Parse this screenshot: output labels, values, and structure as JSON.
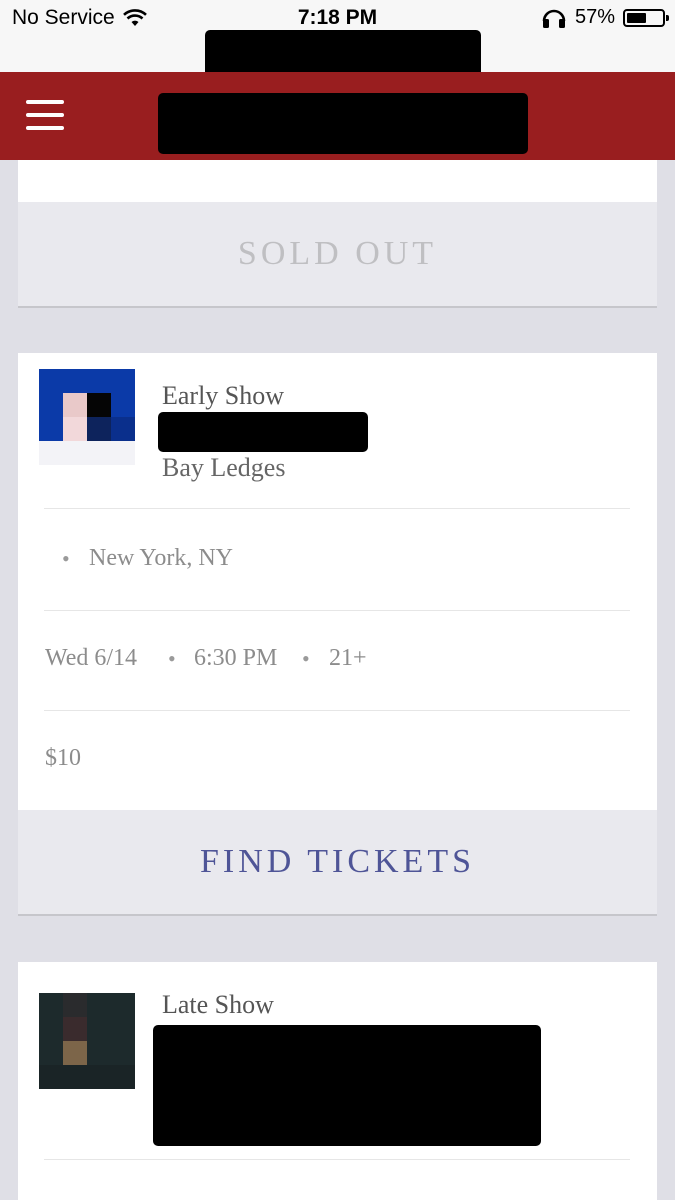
{
  "status_bar": {
    "carrier": "No Service",
    "time": "7:18 PM",
    "battery": "57%",
    "battery_level": 0.57
  },
  "nav": {
    "menu_icon": "hamburger-menu-icon"
  },
  "sold_out": {
    "label": "SOLD OUT"
  },
  "early_show": {
    "show_label": "Early Show",
    "artist": "Bay Ledges",
    "location": "New York, NY",
    "date": "Wed 6/14",
    "time": "6:30 PM",
    "age": "21+",
    "price": "$10",
    "cta": "FIND TICKETS"
  },
  "late_show": {
    "show_label": "Late Show"
  },
  "colors": {
    "header": "#991e1f",
    "background": "#dfdfe6",
    "cta_text": "#4f5597",
    "sold_out_text": "#bfbfc2"
  }
}
